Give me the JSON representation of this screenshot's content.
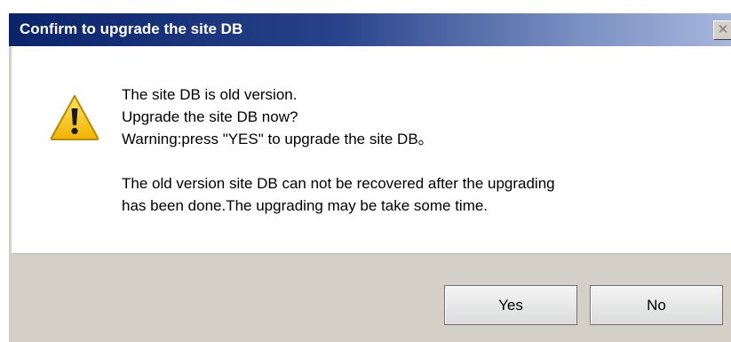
{
  "window": {
    "title": "Confirm to upgrade the site DB",
    "close_glyph": "✕"
  },
  "icon": {
    "name": "warning-icon",
    "color": "#f2c200"
  },
  "message": {
    "lines": [
      "The site DB is old version.",
      "Upgrade the site DB now?",
      "Warning:press \"YES\" to upgrade the site DB。",
      "The old version site DB can not be recovered after the upgrading",
      "has been done.The upgrading may be take some time."
    ]
  },
  "buttons": {
    "yes_label": "Yes",
    "no_label": "No"
  },
  "colors": {
    "titlebar_start": "#0a246a",
    "titlebar_end": "#a6b6dd",
    "footer_bg": "#d4d0c8"
  }
}
